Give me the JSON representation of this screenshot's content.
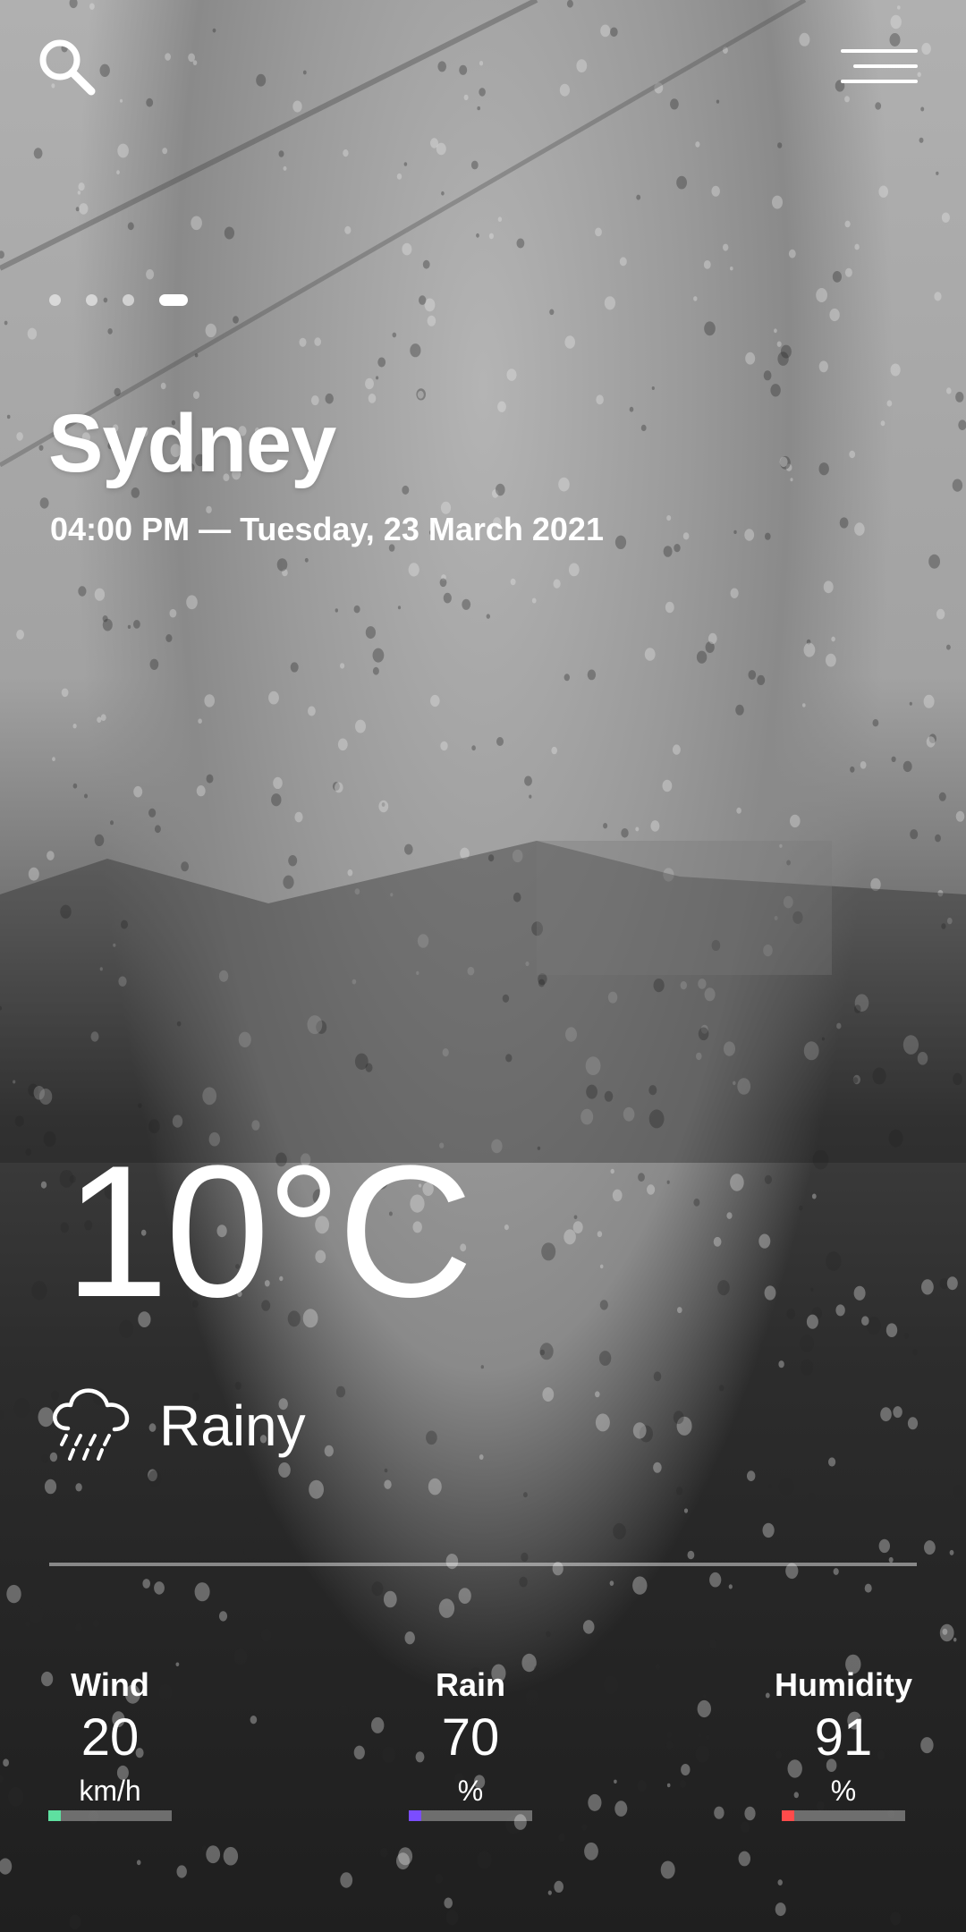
{
  "app": {
    "city": "Sydney",
    "datetime": "04:00 PM — Tuesday, 23 March 2021"
  },
  "pager": {
    "count": 4,
    "active_index": 3
  },
  "current": {
    "temperature": "10°C",
    "condition": "Rainy",
    "condition_icon": "rain-cloud-icon"
  },
  "stats": [
    {
      "label": "Wind",
      "value": "20",
      "unit": "km/h",
      "color": "#5ee0a0",
      "level": 0.1
    },
    {
      "label": "Rain",
      "value": "70",
      "unit": "%",
      "color": "#7b4dff",
      "level": 0.1
    },
    {
      "label": "Humidity",
      "value": "91",
      "unit": "%",
      "color": "#ff4b4b",
      "level": 0.1
    }
  ],
  "icons": {
    "search": "search-icon",
    "menu": "menu-icon"
  }
}
